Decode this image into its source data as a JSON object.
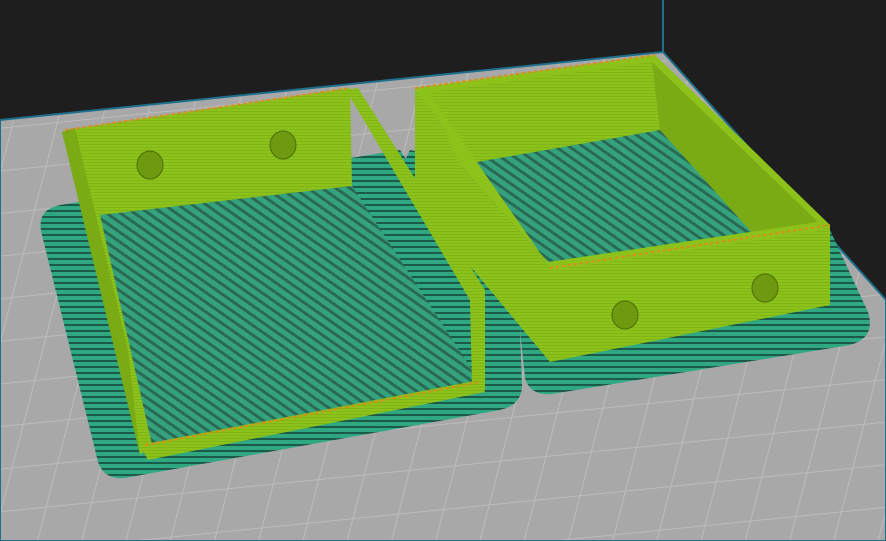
{
  "scene": {
    "colors": {
      "background": "#1e1e1e",
      "build_plate": "#a8a8a8",
      "grid_line": "#bdbdbd",
      "plate_edge": "#1d6f8a",
      "skirt": "#2fa882",
      "skirt_stripe": "#1b5a48",
      "wall": "#8cc21a",
      "wall_shade": "#7aab14",
      "infill": "#35a27e",
      "infill_stripe": "#2a6a55",
      "rim_accent": "#e08a1a"
    }
  }
}
